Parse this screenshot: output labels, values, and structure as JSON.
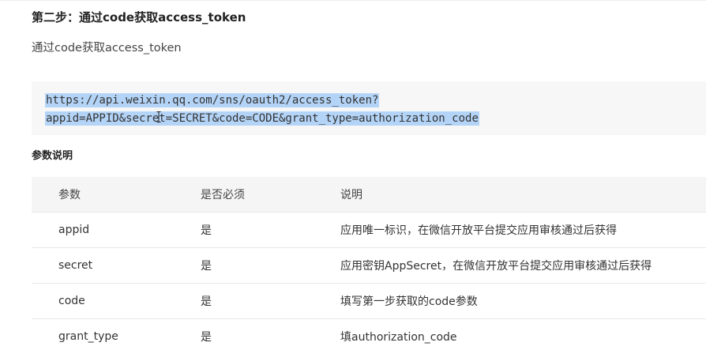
{
  "step": {
    "title": "第二步：通过code获取access_token",
    "description": "通过code获取access_token"
  },
  "request": {
    "line1": "https://api.weixin.qq.com/sns/oauth2/access_token?",
    "line2": "appid=APPID&secret=SECRET&code=CODE&grant_type=authorization_code",
    "selection_color": "#b4d4f7",
    "cursor_icon": "text-cursor-icon"
  },
  "params": {
    "heading": "参数说明",
    "columns": {
      "param": "参数",
      "required": "是否必须",
      "description": "说明"
    },
    "rows": [
      {
        "param": "appid",
        "required": "是",
        "description": "应用唯一标识，在微信开放平台提交应用审核通过后获得"
      },
      {
        "param": "secret",
        "required": "是",
        "description": "应用密钥AppSecret，在微信开放平台提交应用审核通过后获得"
      },
      {
        "param": "code",
        "required": "是",
        "description": "填写第一步获取的code参数"
      },
      {
        "param": "grant_type",
        "required": "是",
        "description": "填authorization_code"
      }
    ]
  }
}
